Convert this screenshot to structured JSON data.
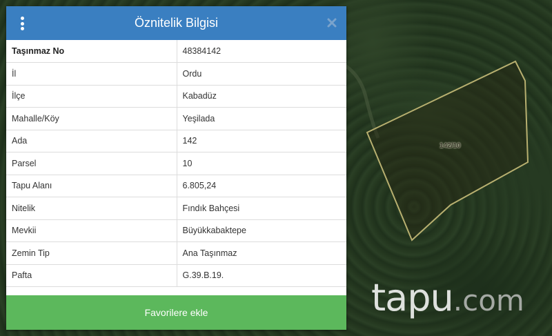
{
  "dialog": {
    "title": "Öznitelik Bilgisi",
    "favorite_button_label": "Favorilere ekle",
    "menu_icon": "vertical-dots-icon",
    "close_icon": "close-icon"
  },
  "attributes": [
    {
      "key": "Taşınmaz No",
      "value": "48384142"
    },
    {
      "key": "İl",
      "value": "Ordu"
    },
    {
      "key": "İlçe",
      "value": "Kabadüz"
    },
    {
      "key": "Mahalle/Köy",
      "value": "Yeşilada"
    },
    {
      "key": "Ada",
      "value": "142"
    },
    {
      "key": "Parsel",
      "value": "10"
    },
    {
      "key": "Tapu Alanı",
      "value": "6.805,24"
    },
    {
      "key": "Nitelik",
      "value": "Fındık Bahçesi"
    },
    {
      "key": "Mevkii",
      "value": "Büyükkabaktepe"
    },
    {
      "key": "Zemin Tip",
      "value": "Ana Taşınmaz"
    },
    {
      "key": "Pafta",
      "value": "G.39.B.19."
    }
  ],
  "map": {
    "parcel_label": "142/10",
    "watermark_main": "tapu",
    "watermark_suffix": ".com"
  },
  "colors": {
    "header": "#3a7fc1",
    "button": "#5cb85c",
    "parcel_outline": "#b8b070"
  }
}
